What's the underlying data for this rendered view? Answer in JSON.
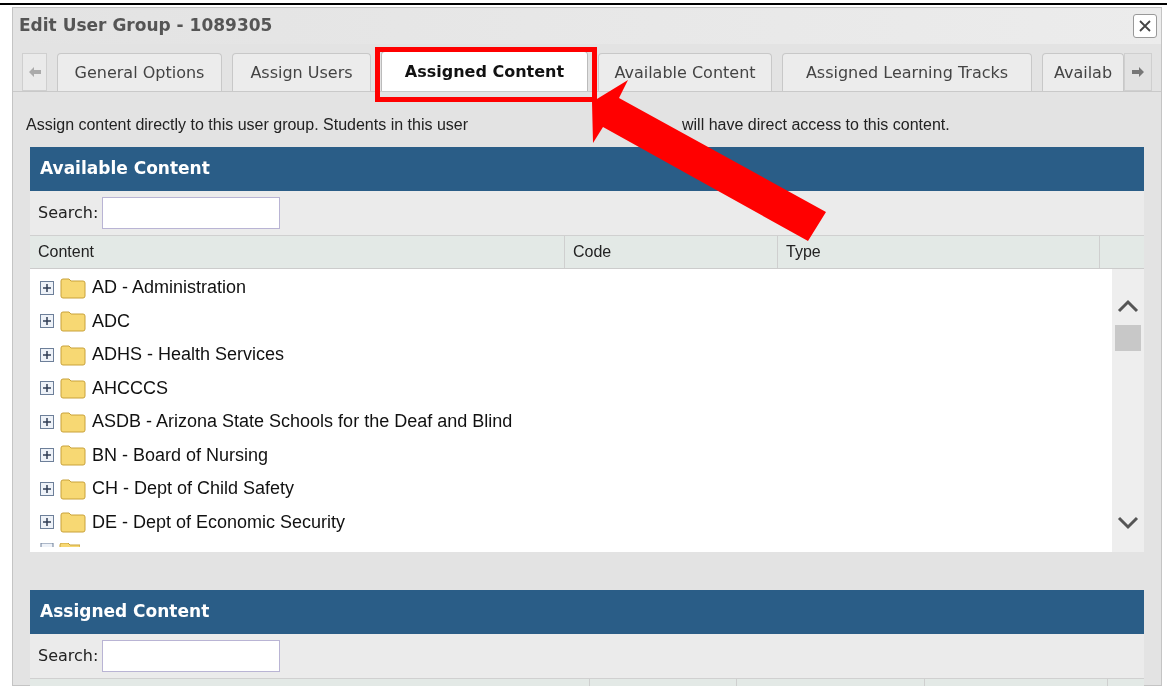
{
  "window": {
    "title": "Edit User Group - 1089305"
  },
  "tabs": [
    {
      "label": "General Options",
      "selected": false
    },
    {
      "label": "Assign Users",
      "selected": false
    },
    {
      "label": "Assigned Content",
      "selected": true
    },
    {
      "label": "Available Content",
      "selected": false
    },
    {
      "label": "Assigned Learning Tracks",
      "selected": false
    },
    {
      "label": "Availab",
      "selected": false
    }
  ],
  "instruction": [
    "Assign content directly to this user group. Students in this user",
    "will have direct access to this content."
  ],
  "available_content": {
    "title": "Available Content",
    "search": {
      "label": "Search:"
    },
    "columns": [
      "Content",
      "Code",
      "Type"
    ],
    "rows": [
      {
        "label": "AD - Administration",
        "expanded": false
      },
      {
        "label": "ADC",
        "expanded": false
      },
      {
        "label": "ADHS - Health Services",
        "expanded": false
      },
      {
        "label": "AHCCCS",
        "expanded": false
      },
      {
        "label": "ASDB - Arizona State Schools for the Deaf and Blind",
        "expanded": false
      },
      {
        "label": "BN - Board of Nursing",
        "expanded": false
      },
      {
        "label": "CH - Dept of Child Safety",
        "expanded": false
      },
      {
        "label": "DE - Dept of Economic Security",
        "expanded": false
      }
    ]
  },
  "assigned_content": {
    "title": "Assigned Content",
    "search": {
      "label": "Search:"
    }
  }
}
